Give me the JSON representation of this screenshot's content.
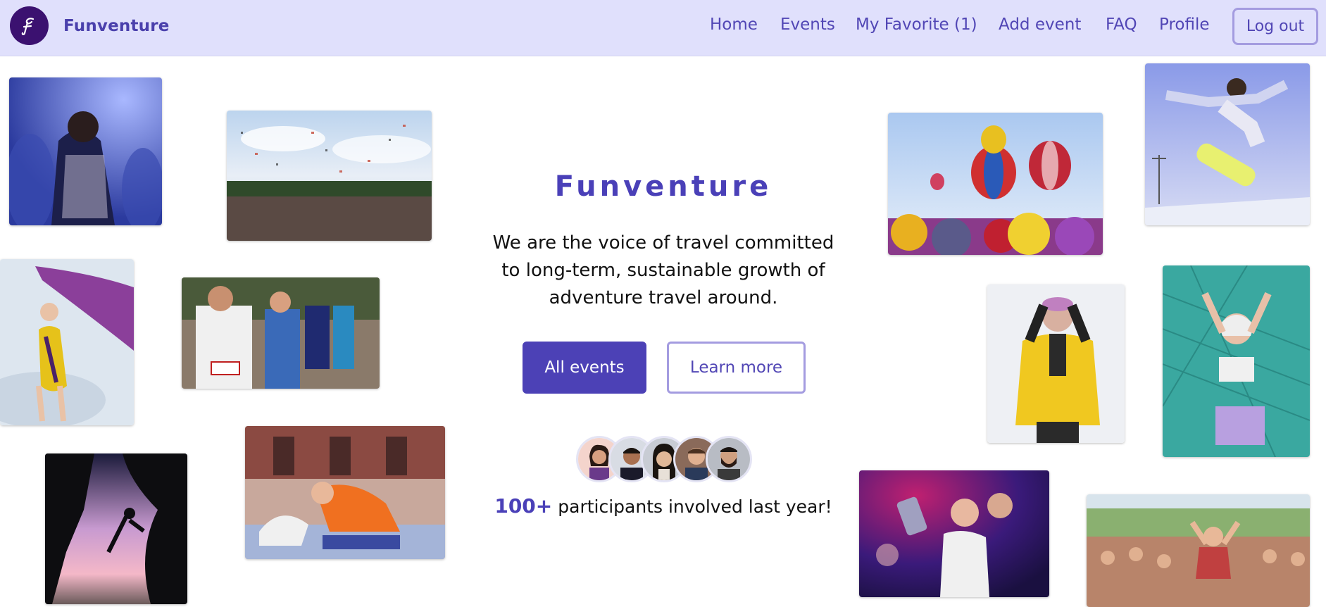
{
  "nav": {
    "brand": "Funventure",
    "links": [
      {
        "label": "Home"
      },
      {
        "label": "Events"
      },
      {
        "label": "My Favorite (1)"
      },
      {
        "label": "Add event"
      },
      {
        "label": "FAQ"
      },
      {
        "label": "Profile"
      }
    ],
    "logout_label": "Log out"
  },
  "hero": {
    "title": "Funventure",
    "description": "We are the voice of travel committed to long-term, sustainable growth of adventure travel around.",
    "primary_button": "All events",
    "secondary_button": "Learn more",
    "participants_count": "100+",
    "participants_text": "participants involved last year!"
  },
  "colors": {
    "nav_background": "#e0e0fc",
    "accent": "#4c41b6",
    "brand_text": "#4a40ac",
    "outline": "#a49ce0",
    "logo_circle": "#3b1170"
  },
  "icons": [
    "funventure-logo-icon"
  ]
}
